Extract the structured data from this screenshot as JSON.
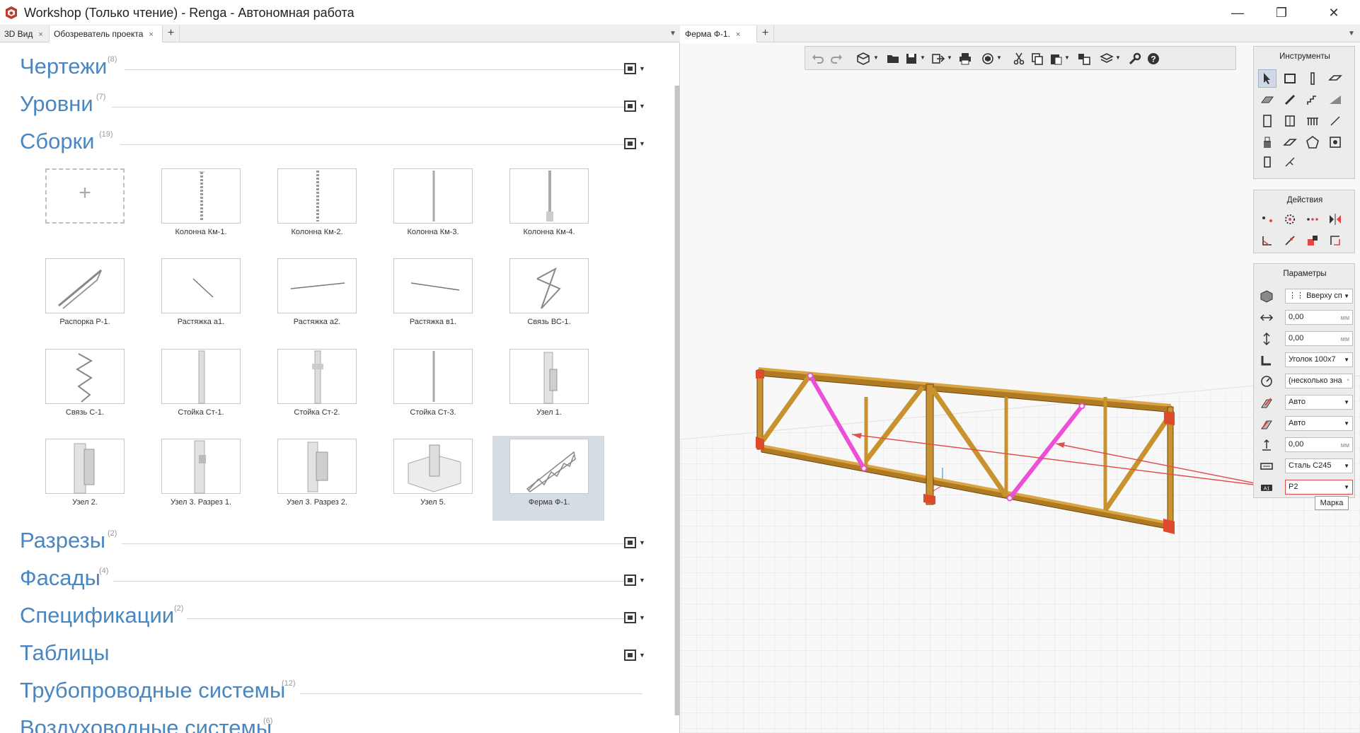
{
  "window": {
    "title": "Workshop (Только чтение) - Renga - Автономная работа",
    "minimize": "—",
    "restore": "❐",
    "close": "✕"
  },
  "left_tabs": {
    "tabs": [
      {
        "label": "3D Вид",
        "close": "×"
      },
      {
        "label": "Обозреватель проекта",
        "close": "×"
      }
    ],
    "add": "+",
    "dropdown": "▼"
  },
  "right_tabs": {
    "tabs": [
      {
        "label": "Ферма Ф-1.",
        "close": "×"
      }
    ],
    "add": "+",
    "dropdown": "▼"
  },
  "sections": [
    {
      "name": "Чертежи",
      "count": "(8)"
    },
    {
      "name": "Уровни",
      "count": "(7)"
    },
    {
      "name": "Сборки",
      "count": "(19)"
    },
    {
      "name": "Разрезы",
      "count": "(2)"
    },
    {
      "name": "Фасады",
      "count": "(4)"
    },
    {
      "name": "Спецификации",
      "count": "(2)"
    },
    {
      "name": "Таблицы",
      "count": ""
    },
    {
      "name": "Трубопроводные системы",
      "count": "(12)"
    },
    {
      "name": "Воздуховодные системы",
      "count": "(6)"
    }
  ],
  "assemblies": {
    "add_label": "+",
    "items": [
      {
        "label": "Колонна Км-1.",
        "icon": "column-thumb"
      },
      {
        "label": "Колонна Км-2.",
        "icon": "column-thumb"
      },
      {
        "label": "Колонна Км-3.",
        "icon": "column-thumb"
      },
      {
        "label": "Колонна Км-4.",
        "icon": "column-thumb"
      },
      {
        "label": "Распорка Р-1.",
        "icon": "strut-thumb"
      },
      {
        "label": "Растяжка а1.",
        "icon": "tie-thumb"
      },
      {
        "label": "Растяжка а2.",
        "icon": "tie-thumb"
      },
      {
        "label": "Растяжка в1.",
        "icon": "tie-thumb"
      },
      {
        "label": "Связь ВС-1.",
        "icon": "brace-thumb"
      },
      {
        "label": "Связь С-1.",
        "icon": "brace-thumb"
      },
      {
        "label": "Стойка Ст-1.",
        "icon": "post-thumb"
      },
      {
        "label": "Стойка Ст-2.",
        "icon": "post-thumb"
      },
      {
        "label": "Стойка Ст-3.",
        "icon": "post-thumb"
      },
      {
        "label": "Узел 1.",
        "icon": "node-thumb"
      },
      {
        "label": "Узел 2.",
        "icon": "node-thumb"
      },
      {
        "label": "Узел 3. Разрез 1.",
        "icon": "node-thumb"
      },
      {
        "label": "Узел 3. Разрез 2.",
        "icon": "node-thumb"
      },
      {
        "label": "Узел 5.",
        "icon": "node-thumb"
      },
      {
        "label": "Ферма Ф-1.",
        "icon": "truss-thumb",
        "selected": true
      }
    ]
  },
  "panels": {
    "tools_title": "Инструменты",
    "actions_title": "Действия",
    "params_title": "Параметры"
  },
  "params": [
    {
      "icon": "placement-icon",
      "value": "Вверху сп",
      "type": "dropdown",
      "prefix": "⋮⋮"
    },
    {
      "icon": "offset-x-icon",
      "value": "0,00",
      "unit": "мм",
      "type": "input"
    },
    {
      "icon": "offset-y-icon",
      "value": "0,00",
      "unit": "мм",
      "type": "input"
    },
    {
      "icon": "profile-icon",
      "value": "Уголок 100х7",
      "type": "dropdown"
    },
    {
      "icon": "rotation-icon",
      "value": "(несколько зна",
      "type": "input",
      "suffix": "°"
    },
    {
      "icon": "cut-start-icon",
      "value": "Авто",
      "type": "dropdown"
    },
    {
      "icon": "cut-end-icon",
      "value": "Авто",
      "type": "dropdown"
    },
    {
      "icon": "offset-z-icon",
      "value": "0,00",
      "unit": "мм",
      "type": "input"
    },
    {
      "icon": "material-icon",
      "value": "Сталь С245",
      "type": "dropdown"
    },
    {
      "icon": "mark-icon",
      "value": "Р2",
      "type": "dropdown",
      "highlight": true
    }
  ],
  "tooltip": "Марка",
  "colors": {
    "accent_blue": "#4a86bf",
    "truss_steel": "#c8922e",
    "selected_member": "#ec4fd8",
    "annotation_arrow": "#e05050",
    "selected_card_bg": "#d6dce3"
  }
}
